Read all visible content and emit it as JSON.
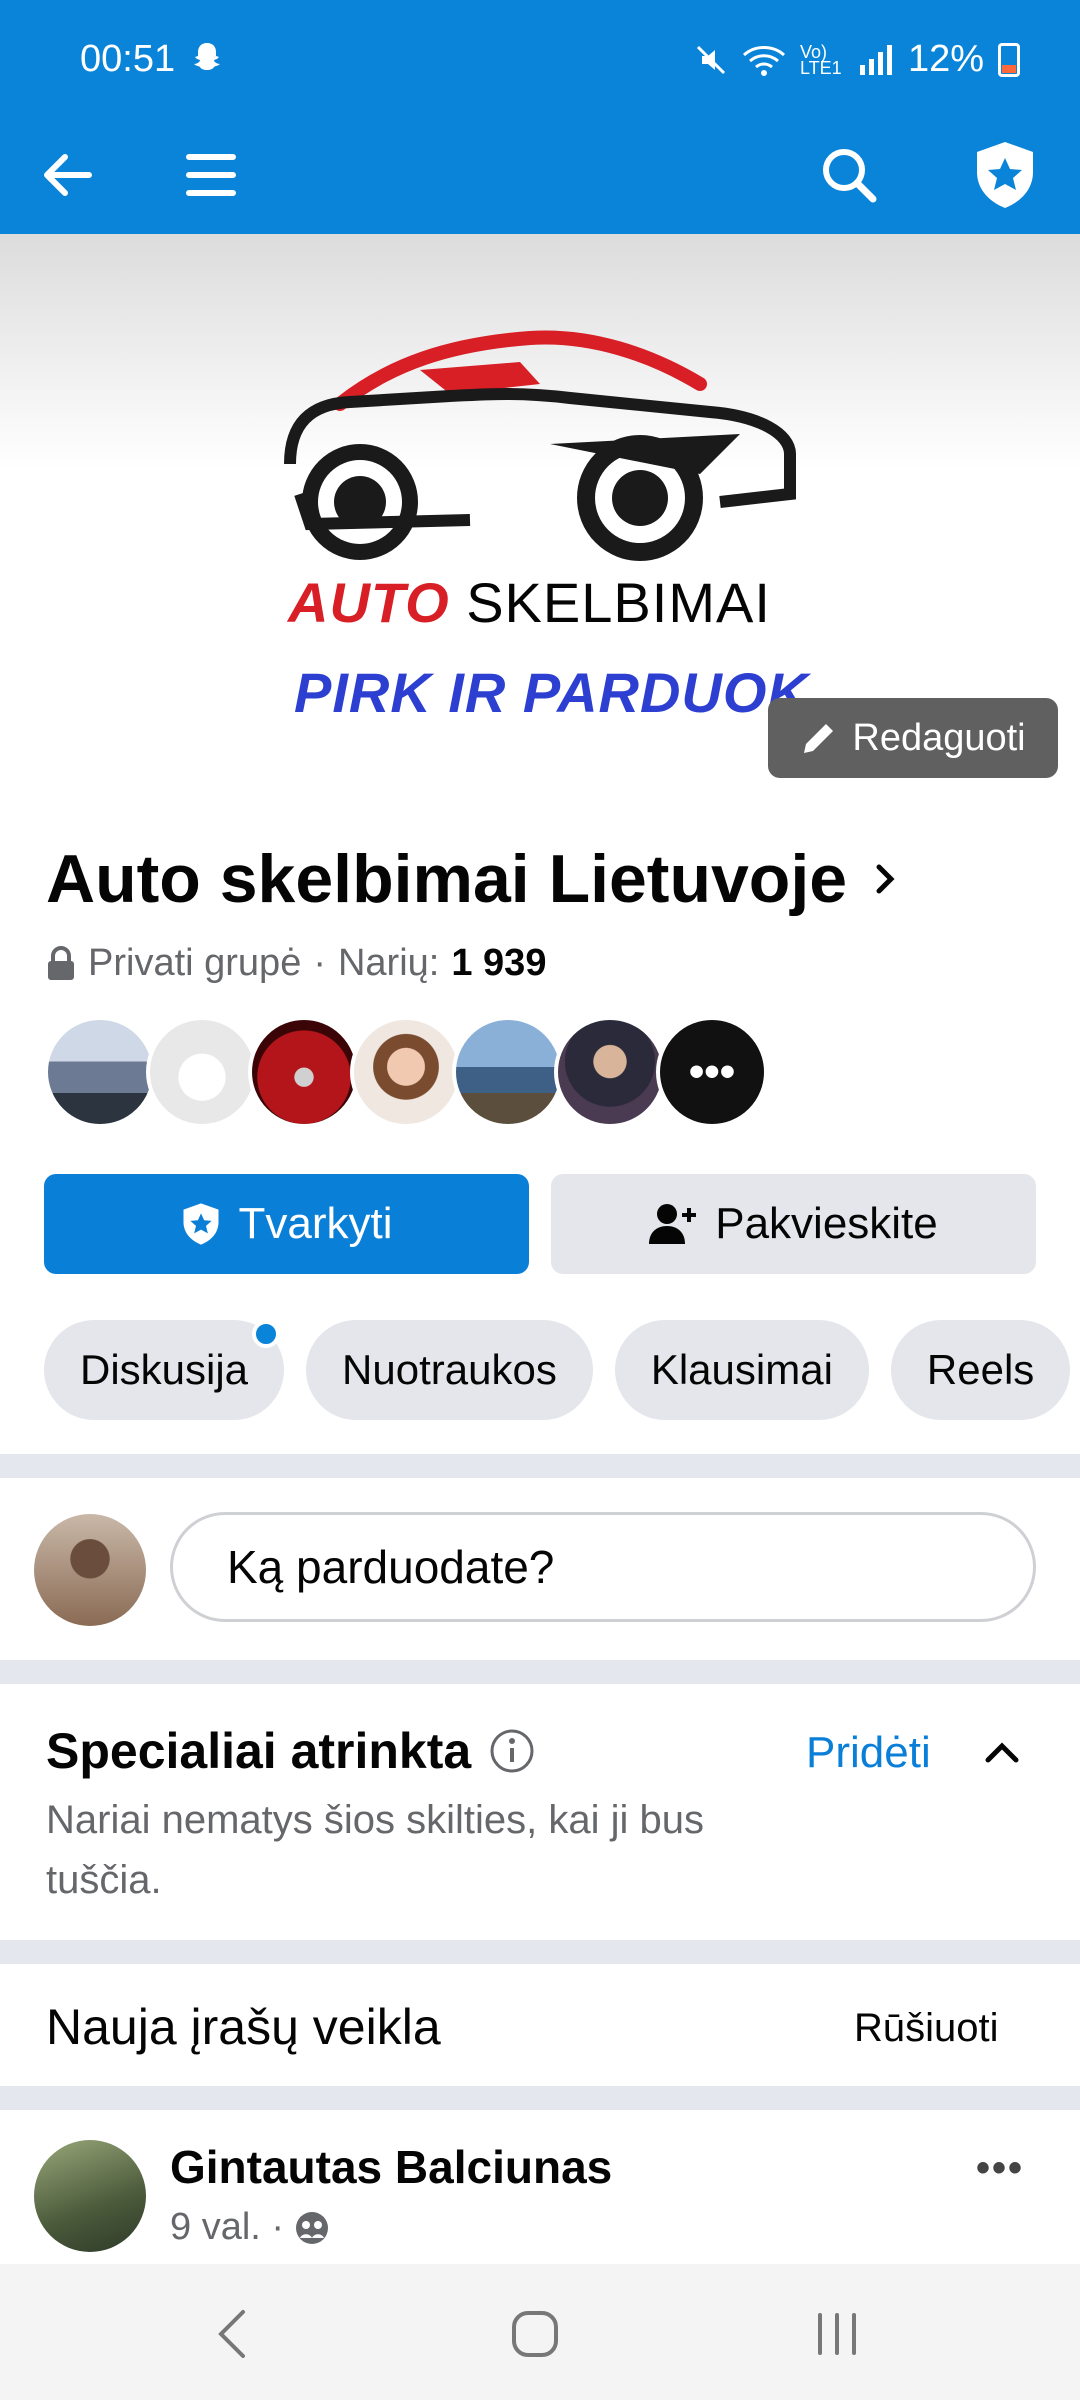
{
  "status": {
    "time": "00:51",
    "battery": "12%",
    "network": "Vo) LTE1"
  },
  "colors": {
    "accent": "#0a84d9",
    "primary_button": "#0a7fd8",
    "brand_red": "#d81f26",
    "brand_blue": "#2c3fd1"
  },
  "cover": {
    "brand_word1": "AUTO",
    "brand_word2": "SKELBIMAI",
    "slogan": "PIRK IR PARDUOK",
    "edit_label": "Redaguoti"
  },
  "group": {
    "name": "Auto skelbimai Lietuvoje",
    "privacy": "Privati grupė",
    "members_label": "Narių:",
    "members_count": "1 939",
    "more_members": "•••"
  },
  "actions": {
    "manage": "Tvarkyti",
    "invite": "Pakvieskite"
  },
  "tabs": [
    "Diskusija",
    "Nuotraukos",
    "Klausimai",
    "Reels"
  ],
  "composer": {
    "placeholder": "Ką parduodate?"
  },
  "featured": {
    "title": "Specialiai atrinkta",
    "description": "Nariai nematys šios skilties, kai ji bus tuščia.",
    "add": "Pridėti"
  },
  "activity": {
    "title": "Nauja įrašų veikla",
    "sort": "Rūšiuoti"
  },
  "post": {
    "author": "Gintautas Balciunas",
    "time": "9 val. ·",
    "more": "•••"
  }
}
